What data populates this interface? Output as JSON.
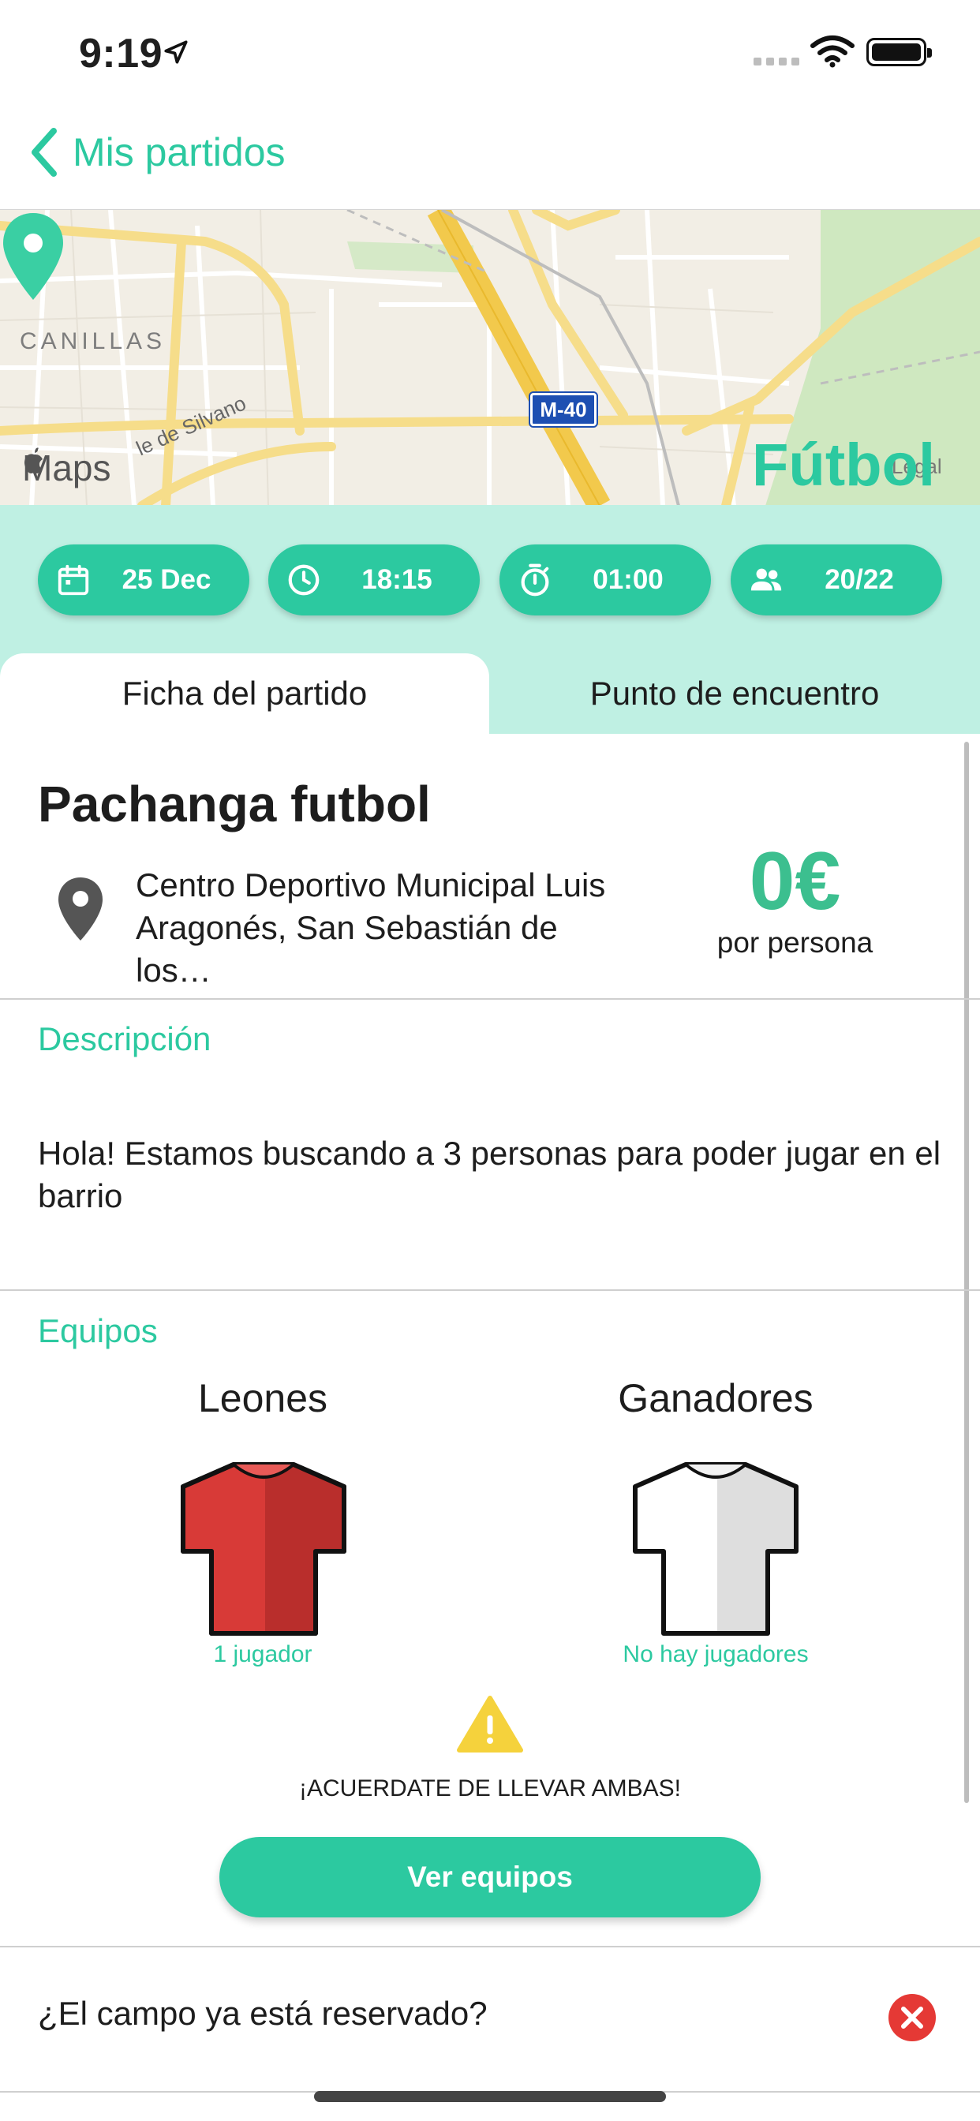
{
  "status_bar": {
    "time": "9:19"
  },
  "nav": {
    "back_label": "Mis partidos"
  },
  "map": {
    "area_label": "CANILLAS",
    "maps_label": "Maps",
    "road_badge": "M-40",
    "street_label": "le de Silvano",
    "legal_label": "Legal",
    "sport": "Fútbol"
  },
  "pills": [
    {
      "icon": "calendar-icon",
      "value": "25 Dec"
    },
    {
      "icon": "clock-icon",
      "value": "18:15"
    },
    {
      "icon": "stopwatch-icon",
      "value": "01:00"
    },
    {
      "icon": "people-icon",
      "value": "20/22"
    }
  ],
  "tabs": [
    {
      "label": "Ficha del partido",
      "active": true
    },
    {
      "label": "Punto de encuentro",
      "active": false
    }
  ],
  "match": {
    "title": "Pachanga futbol",
    "address": "Centro Deportivo Municipal Luis Aragonés, San Sebastián de los…",
    "price": "0€",
    "price_sub": "por persona"
  },
  "description": {
    "heading": "Descripción",
    "text": "Hola! Estamos buscando a 3 personas para poder jugar en el barrio"
  },
  "teams": {
    "heading": "Equipos",
    "list": [
      {
        "name": "Leones",
        "shirt_color": "#D83A37",
        "count": "1 jugador"
      },
      {
        "name": "Ganadores",
        "shirt_color": "#FFFFFF",
        "count": "No hay jugadores"
      }
    ],
    "warning": "¡ACUERDATE DE LLEVAR AMBAS!",
    "cta_label": "Ver equipos"
  },
  "booking": {
    "question": "¿El campo ya está reservado?"
  },
  "colors": {
    "accent": "#2CC9A0",
    "band": "#BFF0E3",
    "danger": "#E53935",
    "warning": "#F5D23C"
  }
}
